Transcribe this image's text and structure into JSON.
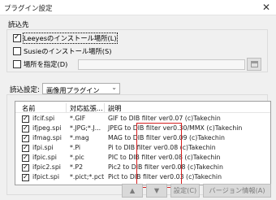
{
  "window": {
    "title": "プラグイン設定",
    "close_glyph": "✕"
  },
  "load_section": {
    "title": "読込先",
    "options": [
      {
        "label": "Leeyesのインストール場所(L)",
        "checked": true
      },
      {
        "label": "Susieのインストール場所(S)",
        "checked": false
      },
      {
        "label": "場所を指定(D)",
        "checked": false
      }
    ],
    "path_value": ""
  },
  "load_settings": {
    "label": "読込設定:",
    "selected": "画像用プラグイン"
  },
  "plugin_list": {
    "columns": [
      "名前",
      "対応拡張...",
      "説明"
    ],
    "rows": [
      {
        "checked": true,
        "name": "ifcif.spi",
        "ext": "*.GIF",
        "desc": "GIF to DIB filter ver0.07 (c)Takechin"
      },
      {
        "checked": true,
        "name": "ifjpeg.spi",
        "ext": "*.JPG;*.J...",
        "desc": "JPEG to DIB filter ver0.30/MMX (c)Takechin"
      },
      {
        "checked": true,
        "name": "ifmag.spi",
        "ext": "*.mag",
        "desc": "MAG to DIB filter ver0.09 (c)Takechin"
      },
      {
        "checked": true,
        "name": "ifpi.spi",
        "ext": "*.Pi",
        "desc": "Pi to DIB filter ver0.08 (c)Takechin"
      },
      {
        "checked": true,
        "name": "ifpic.spi",
        "ext": "*.pic",
        "desc": "PIC to DIB filter ver0.08 (c)Takechin"
      },
      {
        "checked": true,
        "name": "ifpic2.spi",
        "ext": "*.P2",
        "desc": "Pic2 to DIB filter ver0.08 (c)Takechin"
      },
      {
        "checked": true,
        "name": "ifpict.spi",
        "ext": "*.pict;*.pct",
        "desc": "Pict to DIB filter ver0.03 (c)Takechin"
      }
    ]
  },
  "buttons": {
    "up": "▲",
    "down": "▼",
    "settings": "設定(C)",
    "version": "バージョン情報(A)"
  },
  "colors": {
    "highlight_box": "#d62020"
  }
}
